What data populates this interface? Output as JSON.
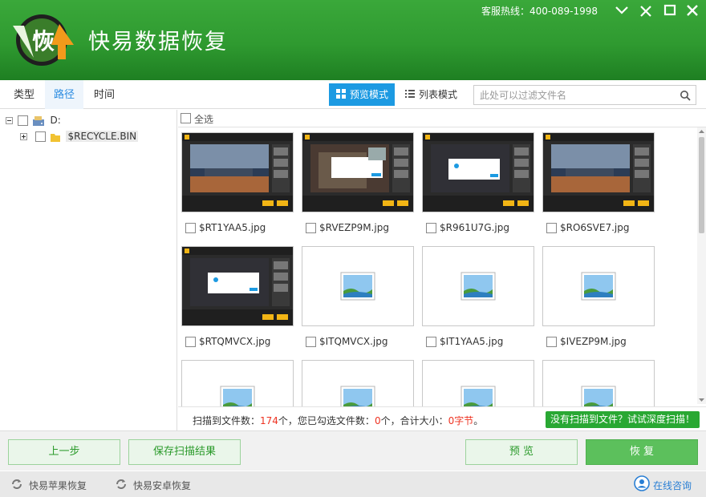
{
  "app": {
    "title": "快易数据恢复",
    "logo_char": "恢"
  },
  "header": {
    "hotline": "客服热线：400-089-1998"
  },
  "window_controls": [
    "chevron-down-icon",
    "restore-icon",
    "maximize-icon",
    "close-icon"
  ],
  "nav_tabs": [
    {
      "label": "类型",
      "active": false
    },
    {
      "label": "路径",
      "active": true
    },
    {
      "label": "时间",
      "active": false
    }
  ],
  "view_modes": [
    {
      "label": "预览模式",
      "icon": "grid-icon",
      "active": true
    },
    {
      "label": "列表模式",
      "icon": "list-icon",
      "active": false
    }
  ],
  "filter": {
    "placeholder": "此处可以过滤文件名",
    "value": ""
  },
  "tree": {
    "drive": {
      "label": "D:",
      "expanded": true
    },
    "folder": {
      "label": "$RECYCLE.BIN",
      "expanded": false
    }
  },
  "select_all": {
    "label": "全选",
    "checked": false
  },
  "files": [
    {
      "name": "$RT1YAA5.jpg",
      "thumb": "app-screenshot-city",
      "checked": false
    },
    {
      "name": "$RVEZP9M.jpg",
      "thumb": "app-screenshot-dialog-photo",
      "checked": false
    },
    {
      "name": "$R961U7G.jpg",
      "thumb": "app-screenshot-dialog",
      "checked": false
    },
    {
      "name": "$RO6SVE7.jpg",
      "thumb": "app-screenshot-city",
      "checked": false
    },
    {
      "name": "$RTQMVCX.jpg",
      "thumb": "app-screenshot-dialog",
      "checked": false
    },
    {
      "name": "$ITQMVCX.jpg",
      "thumb": "image-placeholder-icon",
      "checked": false
    },
    {
      "name": "$IT1YAA5.jpg",
      "thumb": "image-placeholder-icon",
      "checked": false
    },
    {
      "name": "$IVEZP9M.jpg",
      "thumb": "image-placeholder-icon",
      "checked": false
    },
    {
      "name": "",
      "thumb": "image-placeholder-icon",
      "checked": false
    },
    {
      "name": "",
      "thumb": "image-placeholder-icon",
      "checked": false
    },
    {
      "name": "",
      "thumb": "image-placeholder-icon",
      "checked": false
    },
    {
      "name": "",
      "thumb": "image-placeholder-icon",
      "checked": false
    }
  ],
  "status": {
    "prefix": "扫描到文件数：",
    "count": "174",
    "mid1": "个，您已勾选文件数：",
    "selected": "0",
    "mid2": "个，合计大小：",
    "size": "0字节",
    "end": "。"
  },
  "deep_scan_label": "没有扫描到文件？试试深度扫描！",
  "buttons": {
    "back": "上一步",
    "save": "保存扫描结果",
    "preview": "预 览",
    "recover": "恢 复"
  },
  "footer": {
    "apple": "快易苹果恢复",
    "android": "快易安卓恢复",
    "consult": "在线咨询"
  },
  "colors": {
    "header_green": "#2f9a30",
    "accent_blue": "#1c9ae2",
    "deep_scan_green": "#29a833",
    "status_red": "#e33322"
  }
}
